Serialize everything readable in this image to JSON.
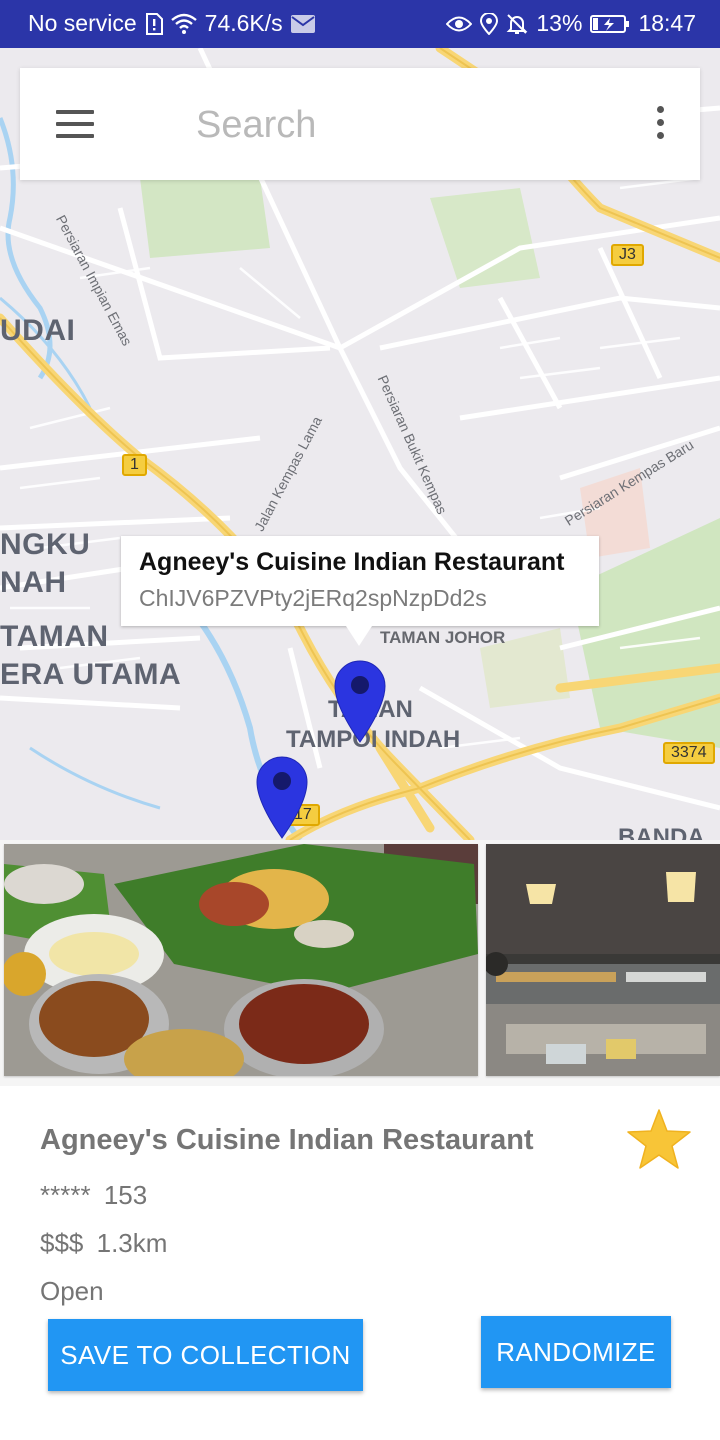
{
  "status_bar": {
    "carrier": "No service",
    "network_speed": "74.6K/s",
    "battery": "13%",
    "time": "18:47",
    "icons": [
      "sim-alert-icon",
      "wifi-icon",
      "mail-icon",
      "eye-icon",
      "location-icon",
      "alarm-off-icon",
      "battery-charging-icon"
    ]
  },
  "search": {
    "placeholder": "Search",
    "value": ""
  },
  "map": {
    "labels": {
      "udai": "UDAI",
      "ngku": "NGKU",
      "nah": "NAH",
      "taman_left": "TAMAN",
      "era_utama": "ERA UTAMA",
      "taman_johor": "TAMAN JOHOR",
      "taman_center": "TAMAN",
      "tampoi_indah": "TAMPOI INDAH",
      "banda": "BANDA",
      "st_impian_emas": "Persiaran Impian Emas",
      "st_kempas_lama": "Jalan Kempas Lama",
      "st_bukit_kempas": "Persiaran Bukit Kempas",
      "st_kempas_baru": "Persiaran Kempas Baru"
    },
    "shields": {
      "j3": "J3",
      "r1": "1",
      "r3374": "3374",
      "r17": "17"
    },
    "marker_color": "#2b35e0"
  },
  "info_window": {
    "title": "Agneey's Cuisine Indian Restaurant",
    "place_id": "ChIJV6PZVPty2jERq2spNzpDd2s"
  },
  "place": {
    "name": "Agneey's Cuisine Indian Restaurant",
    "rating_stars": "*****",
    "rating_count": "153",
    "price": "$$$",
    "distance": "1.3km",
    "status": "Open",
    "favorite_color": "#f8c537"
  },
  "actions": {
    "save_label": "SAVE TO COLLECTION",
    "randomize_label": "RANDOMIZE",
    "accent": "#2196f3"
  }
}
